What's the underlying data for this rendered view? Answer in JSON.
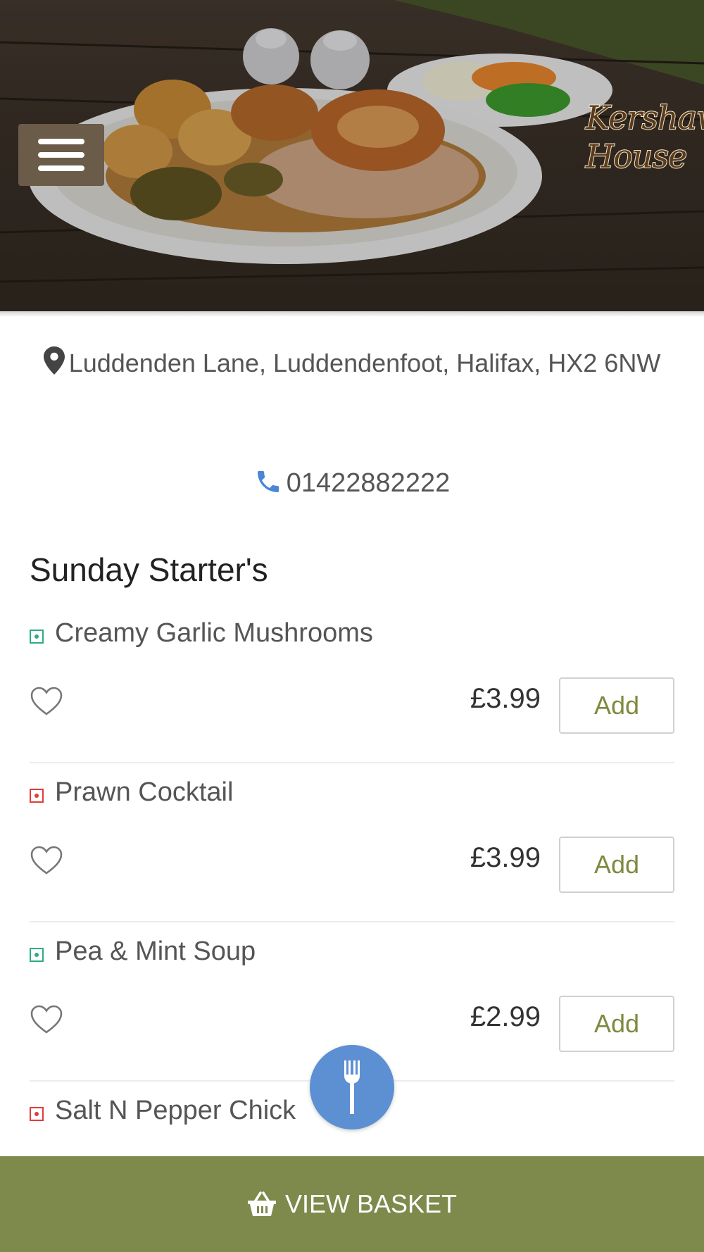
{
  "header": {
    "logo_lines": [
      "Kershaw",
      "House"
    ]
  },
  "info": {
    "address": "Luddenden Lane, Luddendenfoot, Halifax, HX2 6NW",
    "phone": "01422882222"
  },
  "menu": {
    "section_title": "Sunday Starter's",
    "items": [
      {
        "name": "Creamy Garlic Mushrooms",
        "price": "£3.99",
        "add_label": "Add",
        "diet": "veg"
      },
      {
        "name": "Prawn Cocktail",
        "price": "£3.99",
        "add_label": "Add",
        "diet": "non-veg"
      },
      {
        "name": "Pea & Mint Soup",
        "price": "£2.99",
        "add_label": "Add",
        "diet": "veg"
      },
      {
        "name": "Salt N Pepper Chick",
        "price": "",
        "add_label": "",
        "diet": "non-veg"
      }
    ]
  },
  "footer": {
    "basket_label": "VIEW BASKET"
  },
  "icons": {
    "menu": "hamburger-icon",
    "location": "map-pin-icon",
    "phone": "phone-icon",
    "favorite": "heart-icon",
    "fab": "fork-icon",
    "basket": "basket-icon"
  },
  "colors": {
    "accent_green": "#7e8a4c",
    "add_text": "#7e8a3e",
    "fab_blue": "#5d8fd3",
    "veg": "#2eae7f",
    "non_veg": "#e23b3b",
    "menu_button": "#6b5b49"
  }
}
